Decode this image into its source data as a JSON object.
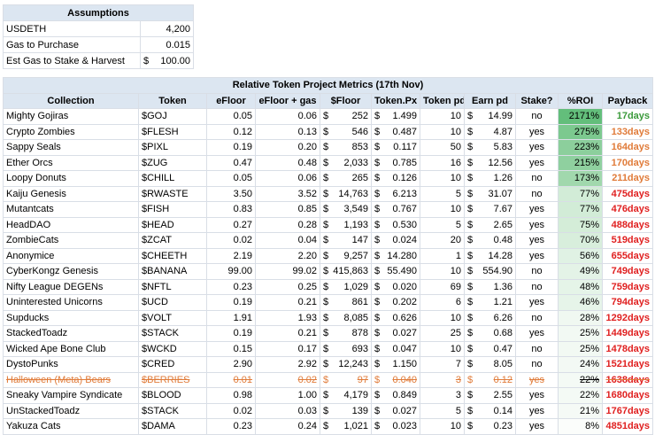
{
  "assumptions": {
    "title": "Assumptions",
    "rows": [
      {
        "label": "USDETH",
        "value": "4,200",
        "prefix": ""
      },
      {
        "label": "Gas to Purchase",
        "value": "0.015",
        "prefix": ""
      },
      {
        "label": "Est Gas to Stake & Harvest",
        "value": "100.00",
        "prefix": "$"
      }
    ]
  },
  "metrics": {
    "title": "Relative Token Project Metrics (17th Nov)",
    "headers": [
      "Collection",
      "Token",
      "eFloor",
      "eFloor + gas",
      "$Floor",
      "Token.Px",
      "Token pd",
      "Earn pd",
      "Stake?",
      "%ROI",
      "Payback"
    ],
    "rows": [
      {
        "collection": "Mighty Gojiras",
        "token": "$GOJ",
        "efloor": "0.05",
        "efloor_gas": "0.06",
        "floor": "252",
        "px": "1.499",
        "tokpd": "10",
        "earn": "14.99",
        "stake": "no",
        "roi": "2171%",
        "roi_color": "#63be7b",
        "payback": "17days",
        "pb_class": "green"
      },
      {
        "collection": "Crypto Zombies",
        "token": "$FLESH",
        "efloor": "0.12",
        "efloor_gas": "0.13",
        "floor": "546",
        "px": "0.487",
        "tokpd": "10",
        "earn": "4.87",
        "stake": "yes",
        "roi": "275%",
        "roi_color": "#7cc98f",
        "payback": "133days",
        "pb_class": "orange"
      },
      {
        "collection": "Sappy Seals",
        "token": "$PIXL",
        "efloor": "0.19",
        "efloor_gas": "0.20",
        "floor": "853",
        "px": "0.117",
        "tokpd": "50",
        "earn": "5.83",
        "stake": "yes",
        "roi": "223%",
        "roi_color": "#8ccf9c",
        "payback": "164days",
        "pb_class": "orange"
      },
      {
        "collection": "Ether Orcs",
        "token": "$ZUG",
        "efloor": "0.47",
        "efloor_gas": "0.48",
        "floor": "2,033",
        "px": "0.785",
        "tokpd": "16",
        "earn": "12.56",
        "stake": "yes",
        "roi": "215%",
        "roi_color": "#8fd09f",
        "payback": "170days",
        "pb_class": "orange"
      },
      {
        "collection": "Loopy Donuts",
        "token": "$CHILL",
        "efloor": "0.05",
        "efloor_gas": "0.06",
        "floor": "265",
        "px": "0.126",
        "tokpd": "10",
        "earn": "1.26",
        "stake": "no",
        "roi": "173%",
        "roi_color": "#a1d8ad",
        "payback": "211days",
        "pb_class": "orange"
      },
      {
        "collection": "Kaiju Genesis",
        "token": "$RWASTE",
        "efloor": "3.50",
        "efloor_gas": "3.52",
        "floor": "14,763",
        "px": "6.213",
        "tokpd": "5",
        "earn": "31.07",
        "stake": "no",
        "roi": "77%",
        "roi_color": "#d2ecd7",
        "payback": "475days",
        "pb_class": "red"
      },
      {
        "collection": "Mutantcats",
        "token": "$FISH",
        "efloor": "0.83",
        "efloor_gas": "0.85",
        "floor": "3,549",
        "px": "0.767",
        "tokpd": "10",
        "earn": "7.67",
        "stake": "yes",
        "roi": "77%",
        "roi_color": "#d2ecd7",
        "payback": "476days",
        "pb_class": "red"
      },
      {
        "collection": "HeadDAO",
        "token": "$HEAD",
        "efloor": "0.27",
        "efloor_gas": "0.28",
        "floor": "1,193",
        "px": "0.530",
        "tokpd": "5",
        "earn": "2.65",
        "stake": "yes",
        "roi": "75%",
        "roi_color": "#d4edd8",
        "payback": "488days",
        "pb_class": "red"
      },
      {
        "collection": "ZombieCats",
        "token": "$ZCAT",
        "efloor": "0.02",
        "efloor_gas": "0.04",
        "floor": "147",
        "px": "0.024",
        "tokpd": "20",
        "earn": "0.48",
        "stake": "yes",
        "roi": "70%",
        "roi_color": "#d8eedc",
        "payback": "519days",
        "pb_class": "red"
      },
      {
        "collection": "Anonymice",
        "token": "$CHEETH",
        "efloor": "2.19",
        "efloor_gas": "2.20",
        "floor": "9,257",
        "px": "14.280",
        "tokpd": "1",
        "earn": "14.28",
        "stake": "yes",
        "roi": "56%",
        "roi_color": "#e0f2e4",
        "payback": "655days",
        "pb_class": "red"
      },
      {
        "collection": "CyberKongz Genesis",
        "token": "$BANANA",
        "efloor": "99.00",
        "efloor_gas": "99.02",
        "floor": "415,863",
        "px": "55.490",
        "tokpd": "10",
        "earn": "554.90",
        "stake": "no",
        "roi": "49%",
        "roi_color": "#e4f3e7",
        "payback": "749days",
        "pb_class": "red"
      },
      {
        "collection": "Nifty League DEGENs",
        "token": "$NFTL",
        "efloor": "0.23",
        "efloor_gas": "0.25",
        "floor": "1,029",
        "px": "0.020",
        "tokpd": "69",
        "earn": "1.36",
        "stake": "no",
        "roi": "48%",
        "roi_color": "#e5f4e8",
        "payback": "759days",
        "pb_class": "red"
      },
      {
        "collection": "Uninterested Unicorns",
        "token": "$UCD",
        "efloor": "0.19",
        "efloor_gas": "0.21",
        "floor": "861",
        "px": "0.202",
        "tokpd": "6",
        "earn": "1.21",
        "stake": "yes",
        "roi": "46%",
        "roi_color": "#e6f4e9",
        "payback": "794days",
        "pb_class": "red"
      },
      {
        "collection": "Supducks",
        "token": "$VOLT",
        "efloor": "1.91",
        "efloor_gas": "1.93",
        "floor": "8,085",
        "px": "0.626",
        "tokpd": "10",
        "earn": "6.26",
        "stake": "no",
        "roi": "28%",
        "roi_color": "#f0f8f1",
        "payback": "1292days",
        "pb_class": "red"
      },
      {
        "collection": "StackedToadz",
        "token": "$STACK",
        "efloor": "0.19",
        "efloor_gas": "0.21",
        "floor": "878",
        "px": "0.027",
        "tokpd": "25",
        "earn": "0.68",
        "stake": "yes",
        "roi": "25%",
        "roi_color": "#f2f9f3",
        "payback": "1449days",
        "pb_class": "red"
      },
      {
        "collection": "Wicked Ape Bone Club",
        "token": "$WCKD",
        "efloor": "0.15",
        "efloor_gas": "0.17",
        "floor": "693",
        "px": "0.047",
        "tokpd": "10",
        "earn": "0.47",
        "stake": "no",
        "roi": "25%",
        "roi_color": "#f2f9f3",
        "payback": "1478days",
        "pb_class": "red"
      },
      {
        "collection": "DystoPunks",
        "token": "$CRED",
        "efloor": "2.90",
        "efloor_gas": "2.92",
        "floor": "12,243",
        "px": "1.150",
        "tokpd": "7",
        "earn": "8.05",
        "stake": "no",
        "roi": "24%",
        "roi_color": "#f3f9f4",
        "payback": "1521days",
        "pb_class": "red"
      },
      {
        "collection": "Halloween (Meta) Bears",
        "token": "$BERRIES",
        "efloor": "0.01",
        "efloor_gas": "0.02",
        "floor": "97",
        "px": "0.040",
        "tokpd": "3",
        "earn": "0.12",
        "stake": "yes",
        "roi": "22%",
        "roi_color": "#f4faf5",
        "payback": "1638days",
        "pb_class": "red",
        "struck": true
      },
      {
        "collection": "Sneaky Vampire Syndicate",
        "token": "$BLOOD",
        "efloor": "0.98",
        "efloor_gas": "1.00",
        "floor": "4,179",
        "px": "0.849",
        "tokpd": "3",
        "earn": "2.55",
        "stake": "yes",
        "roi": "22%",
        "roi_color": "#f4faf5",
        "payback": "1680days",
        "pb_class": "red"
      },
      {
        "collection": "UnStackedToadz",
        "token": "$STACK",
        "efloor": "0.02",
        "efloor_gas": "0.03",
        "floor": "139",
        "px": "0.027",
        "tokpd": "5",
        "earn": "0.14",
        "stake": "yes",
        "roi": "21%",
        "roi_color": "#f5faf6",
        "payback": "1767days",
        "pb_class": "red"
      },
      {
        "collection": "Yakuza Cats",
        "token": "$DAMA",
        "efloor": "0.23",
        "efloor_gas": "0.24",
        "floor": "1,021",
        "px": "0.023",
        "tokpd": "10",
        "earn": "0.23",
        "stake": "yes",
        "roi": "8%",
        "roi_color": "#fbfdfb",
        "payback": "4851days",
        "pb_class": "red"
      }
    ]
  }
}
